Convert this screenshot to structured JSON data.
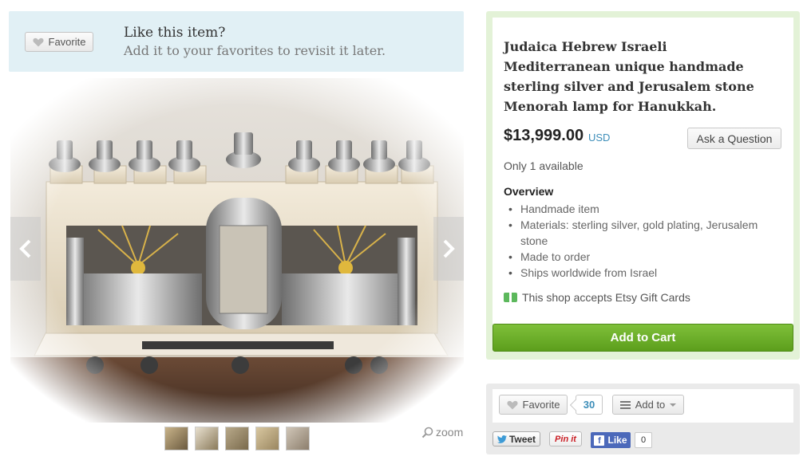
{
  "favorite_banner": {
    "button_label": "Favorite",
    "title": "Like this item?",
    "subtitle": "Add it to your favorites to revisit it later."
  },
  "gallery": {
    "thumbnail_count": 5,
    "zoom_label": "zoom",
    "icons": [
      "chevron-left-icon",
      "chevron-right-icon",
      "magnifier-icon"
    ]
  },
  "listing": {
    "title": "Judaica Hebrew Israeli Mediterranean unique handmade sterling silver and Jerusalem stone Menorah lamp for Hanukkah.",
    "price": "$13,999.00",
    "currency": "USD",
    "ask_question_label": "Ask a Question",
    "availability": "Only 1 available",
    "overview_heading": "Overview",
    "overview_items": [
      "Handmade item",
      "Materials: sterling silver, gold plating, Jerusalem stone",
      "Made to order",
      "Ships worldwide from Israel"
    ],
    "gift_card_text": "This shop accepts Etsy Gift Cards",
    "add_to_cart_label": "Add to Cart"
  },
  "social": {
    "favorite_label": "Favorite",
    "favorite_count": "30",
    "add_to_label": "Add to",
    "tweet_label": "Tweet",
    "pin_label": "Pin it",
    "like_label": "Like",
    "like_count": "0"
  },
  "colors": {
    "accent_green": "#6aaf28",
    "link_blue": "#3d8eb9",
    "banner_blue": "#e1f0f5",
    "buy_box_green": "#e3f2d7",
    "facebook_blue": "#4c69ba",
    "pinterest_red": "#cb2027"
  }
}
